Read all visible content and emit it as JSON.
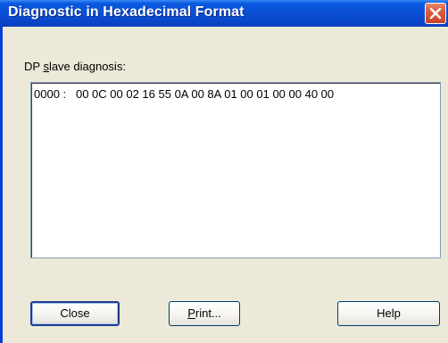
{
  "window": {
    "title": "Diagnostic in Hexadecimal Format"
  },
  "close_icon": "close-icon",
  "diagnosis": {
    "label_pre": "DP ",
    "label_mnemonic": "s",
    "label_post": "lave diagnosis:",
    "lines": [
      "0000 :   00 0C 00 02 16 55 0A 00 8A 01 00 01 00 00 40 00"
    ]
  },
  "buttons": {
    "close_label": "Close",
    "print_mnemonic": "P",
    "print_rest": "rint...",
    "help_label": "Help"
  },
  "colors": {
    "titlebar": "#0a4fd4",
    "dialog_background": "#ece9d8",
    "close_button": "#d8593a"
  }
}
